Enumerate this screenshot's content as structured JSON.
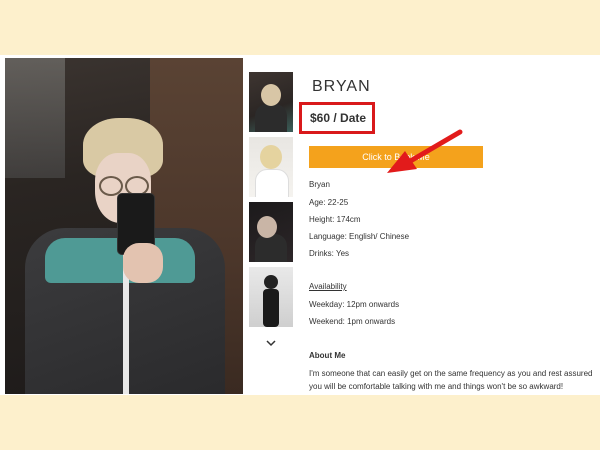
{
  "profile": {
    "name": "BRYAN",
    "price": "$60 / Date",
    "book_button": "Click to Book Me",
    "details": [
      "Bryan",
      "Age: 22-25",
      "Height: 174cm",
      "Language: English/ Chinese",
      "Drinks: Yes"
    ],
    "availability_heading": "Availability",
    "availability": [
      "Weekday: 12pm onwards",
      "Weekend: 1pm onwards"
    ],
    "about_heading": "About Me",
    "about_text": "I'm someone that can easily get on the same frequency as you and rest assured you will be comfortable talking with me and things won't be so awkward!"
  },
  "thumbnails": [
    "photo-1",
    "photo-2",
    "photo-3",
    "photo-4"
  ],
  "icons": {
    "more_thumbnails": "chevron-down-icon",
    "annotation": "red-arrow-icon"
  },
  "colors": {
    "background": "#fdf0cc",
    "button": "#f4a21c",
    "highlight": "#d9191b"
  }
}
